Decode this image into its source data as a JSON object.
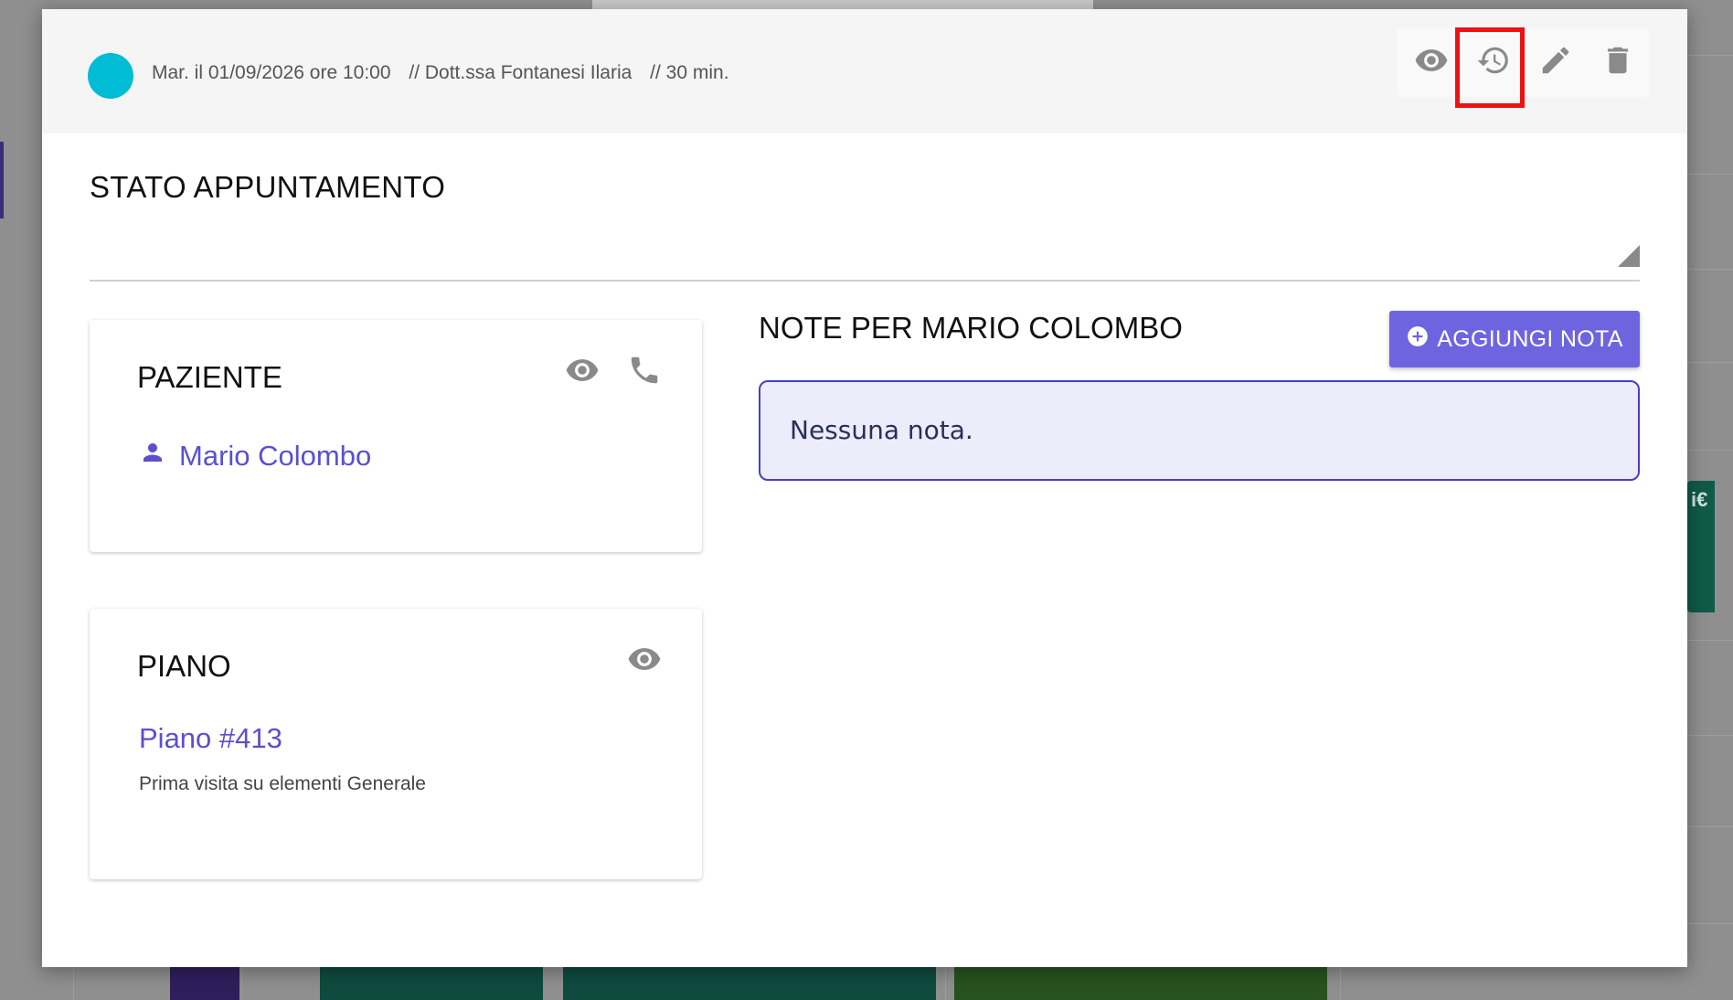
{
  "header": {
    "status_color": "#00bcd4",
    "date_text": "Mar. il 01/09/2026 ore 10:00",
    "doctor_text": "// Dott.ssa Fontanesi Ilaria",
    "duration_text": "// 30 min.",
    "toolbar": [
      {
        "icon": "eye-icon",
        "action": "view"
      },
      {
        "icon": "history-icon",
        "action": "history",
        "highlighted": true
      },
      {
        "icon": "pencil-icon",
        "action": "edit"
      },
      {
        "icon": "trash-icon",
        "action": "delete"
      }
    ]
  },
  "state": {
    "title": "STATO APPUNTAMENTO",
    "value": ""
  },
  "patient_card": {
    "title": "PAZIENTE",
    "name": "Mario Colombo",
    "icons": [
      "eye-icon",
      "phone-icon",
      "person-icon"
    ]
  },
  "plan_card": {
    "title": "PIANO",
    "plan_link": "Piano #413",
    "description": "Prima visita su elementi Generale",
    "icons": [
      "eye-icon"
    ]
  },
  "notes": {
    "title": "NOTE PER MARIO COLOMBO",
    "add_button_label": "AGGIUNGI NOTA",
    "empty_text": "Nessuna nota."
  },
  "background": {
    "event_badge": "i€"
  },
  "colors": {
    "accent": "#6f64e0",
    "link": "#5b4fd0",
    "highlight": "#ee1111"
  }
}
